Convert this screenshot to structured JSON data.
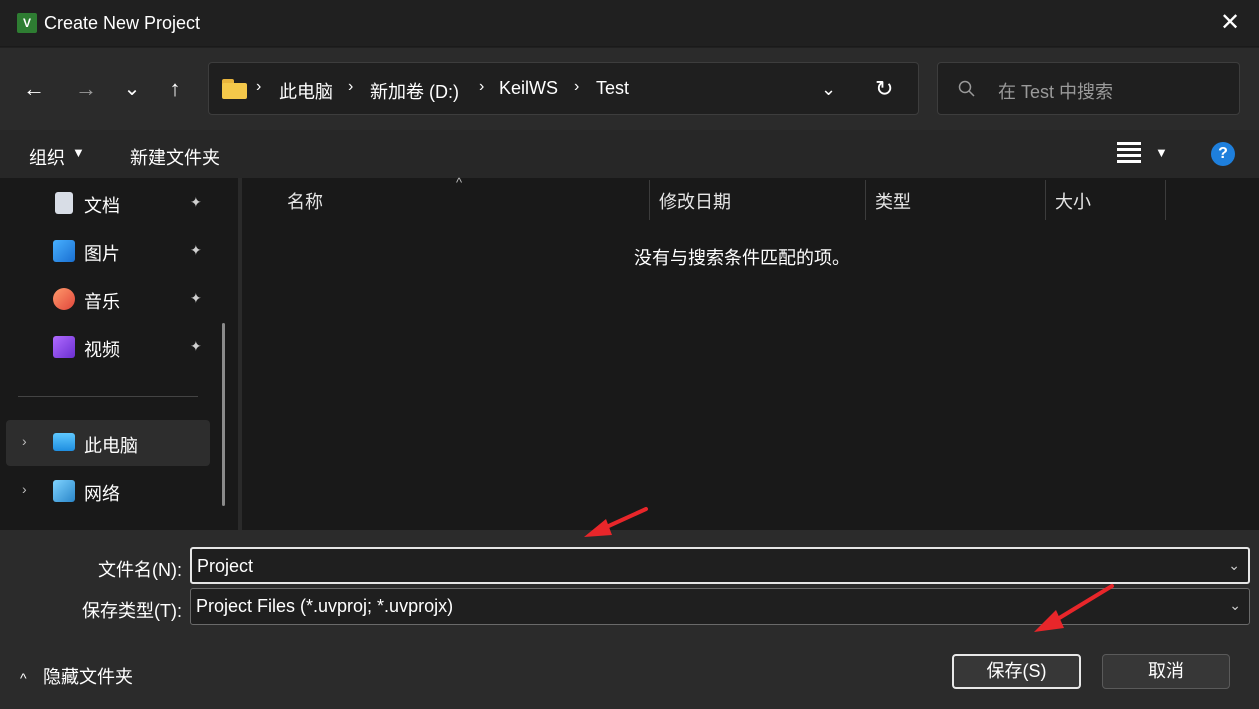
{
  "window": {
    "title": "Create New Project",
    "app_icon_text": "V",
    "close_glyph": "✕"
  },
  "nav": {
    "back_glyph": "←",
    "forward_glyph": "→",
    "recent_glyph": "⌄",
    "up_glyph": "↑"
  },
  "address": {
    "segments": [
      "此电脑",
      "新加卷 (D:)",
      "KeilWS",
      "Test"
    ],
    "separator": "›",
    "dropdown_glyph": "⌄",
    "refresh_glyph": "↻"
  },
  "search": {
    "placeholder": "在 Test 中搜索"
  },
  "commands": {
    "organize": "组织",
    "new_folder": "新建文件夹",
    "help_glyph": "?"
  },
  "sidebar": {
    "items": [
      {
        "label": "文档",
        "icon": "document-icon",
        "pinned": true
      },
      {
        "label": "图片",
        "icon": "pictures-icon",
        "pinned": true
      },
      {
        "label": "音乐",
        "icon": "music-icon",
        "pinned": true
      },
      {
        "label": "视频",
        "icon": "videos-icon",
        "pinned": true
      },
      {
        "label": "此电脑",
        "icon": "computer-icon",
        "selected": true
      },
      {
        "label": "网络",
        "icon": "network-icon"
      }
    ],
    "pin_glyph": "📌",
    "expand_glyph": "›"
  },
  "filelist": {
    "columns": [
      "名称",
      "修改日期",
      "类型",
      "大小"
    ],
    "sort_glyph": "^",
    "empty_message": "没有与搜索条件匹配的项。"
  },
  "form": {
    "filename_label": "文件名(N):",
    "filename_value": "Project",
    "filetype_label": "保存类型(T):",
    "filetype_value": "Project Files (*.uvproj; *.uvprojx)",
    "caret_glyph": "⌄"
  },
  "footer": {
    "hide_folders": "隐藏文件夹",
    "hide_arrow": "^",
    "save_button": "保存(S)",
    "cancel_button": "取消"
  },
  "colors": {
    "background": "#202020",
    "accent_arrow": "#e8262a",
    "help_blue": "#1e7fdc",
    "folder_yellow": "#f4c84a"
  }
}
